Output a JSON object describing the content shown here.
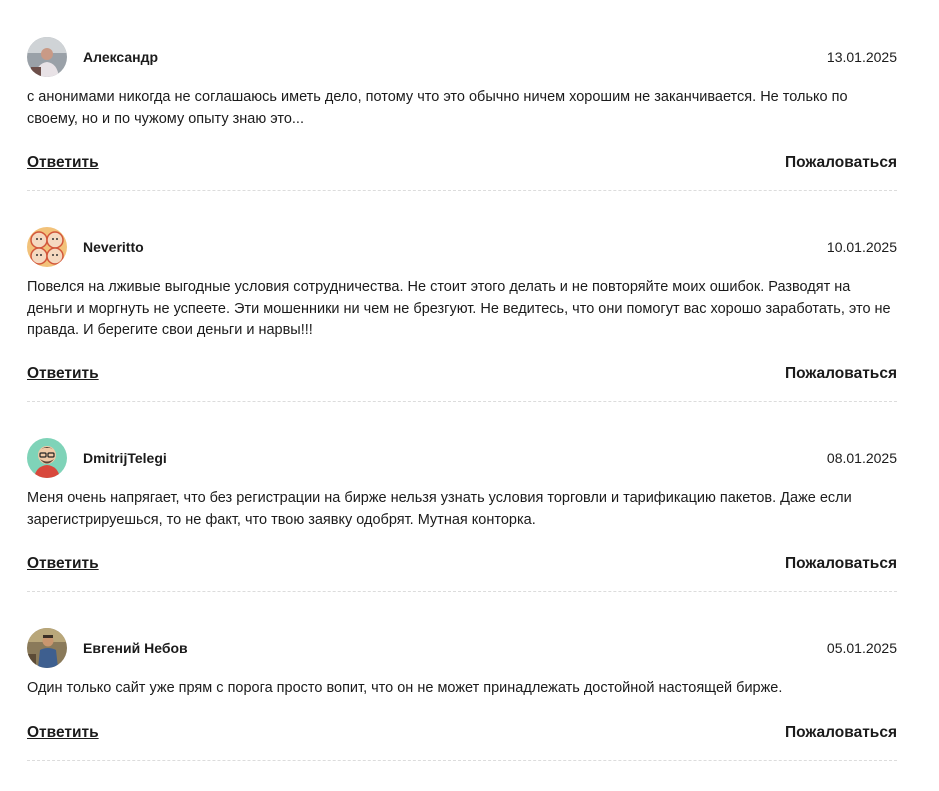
{
  "comments": [
    {
      "author": "Александр",
      "date": "13.01.2025",
      "text": "с анонимами никогда не соглашаюсь иметь дело, потому что это обычно ничем хорошим не заканчивается. Не только по своему, но и по чужому опыту знаю это...",
      "avatar_icon": "user-photo-icon"
    },
    {
      "author": "Neveritto",
      "date": "10.01.2025",
      "text": "Повелся на лживые выгодные условия сотрудничества. Не стоит этого делать и не повторяйте моих ошибок. Разводят на деньги и моргнуть не успеете. Эти мошенники ни чем не брезгуют. Не ведитесь, что они помогут вас хорошо заработать, это не правда. И берегите свои деньги и нарвы!!!",
      "avatar_icon": "illustrated-faces-icon"
    },
    {
      "author": "DmitrijTelegi",
      "date": "08.01.2025",
      "text": "Меня очень напрягает, что без регистрации на бирже нельзя узнать условия торговли и тарификацию пакетов. Даже если зарегистрируешься, то не факт, что твою заявку одобрят. Мутная конторка.",
      "avatar_icon": "cartoon-man-icon"
    },
    {
      "author": "Евгений Небов",
      "date": "05.01.2025",
      "text": "Один только сайт уже прям с порога просто вопит, что он не может принадлежать достойной настоящей бирже.",
      "avatar_icon": "user-photo-icon"
    }
  ],
  "actions": {
    "reply_label": "Ответить",
    "report_label": "Пожаловаться"
  },
  "colors": {
    "text": "#1b1b1b",
    "divider": "#dcdcdc",
    "background": "#ffffff"
  }
}
